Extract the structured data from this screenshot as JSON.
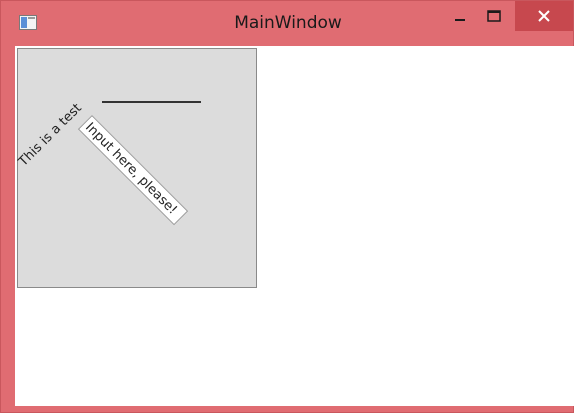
{
  "window": {
    "title": "MainWindow",
    "icons": {
      "app": "app-window-icon",
      "minimize": "minimize-icon",
      "maximize": "maximize-icon",
      "close": "close-icon"
    },
    "colors": {
      "frame": "#e06c72",
      "close_button": "#c7484e",
      "canvas_background": "#dcdcdc"
    }
  },
  "content": {
    "label_text": "This is a test",
    "input_value": "Input here, please!"
  }
}
